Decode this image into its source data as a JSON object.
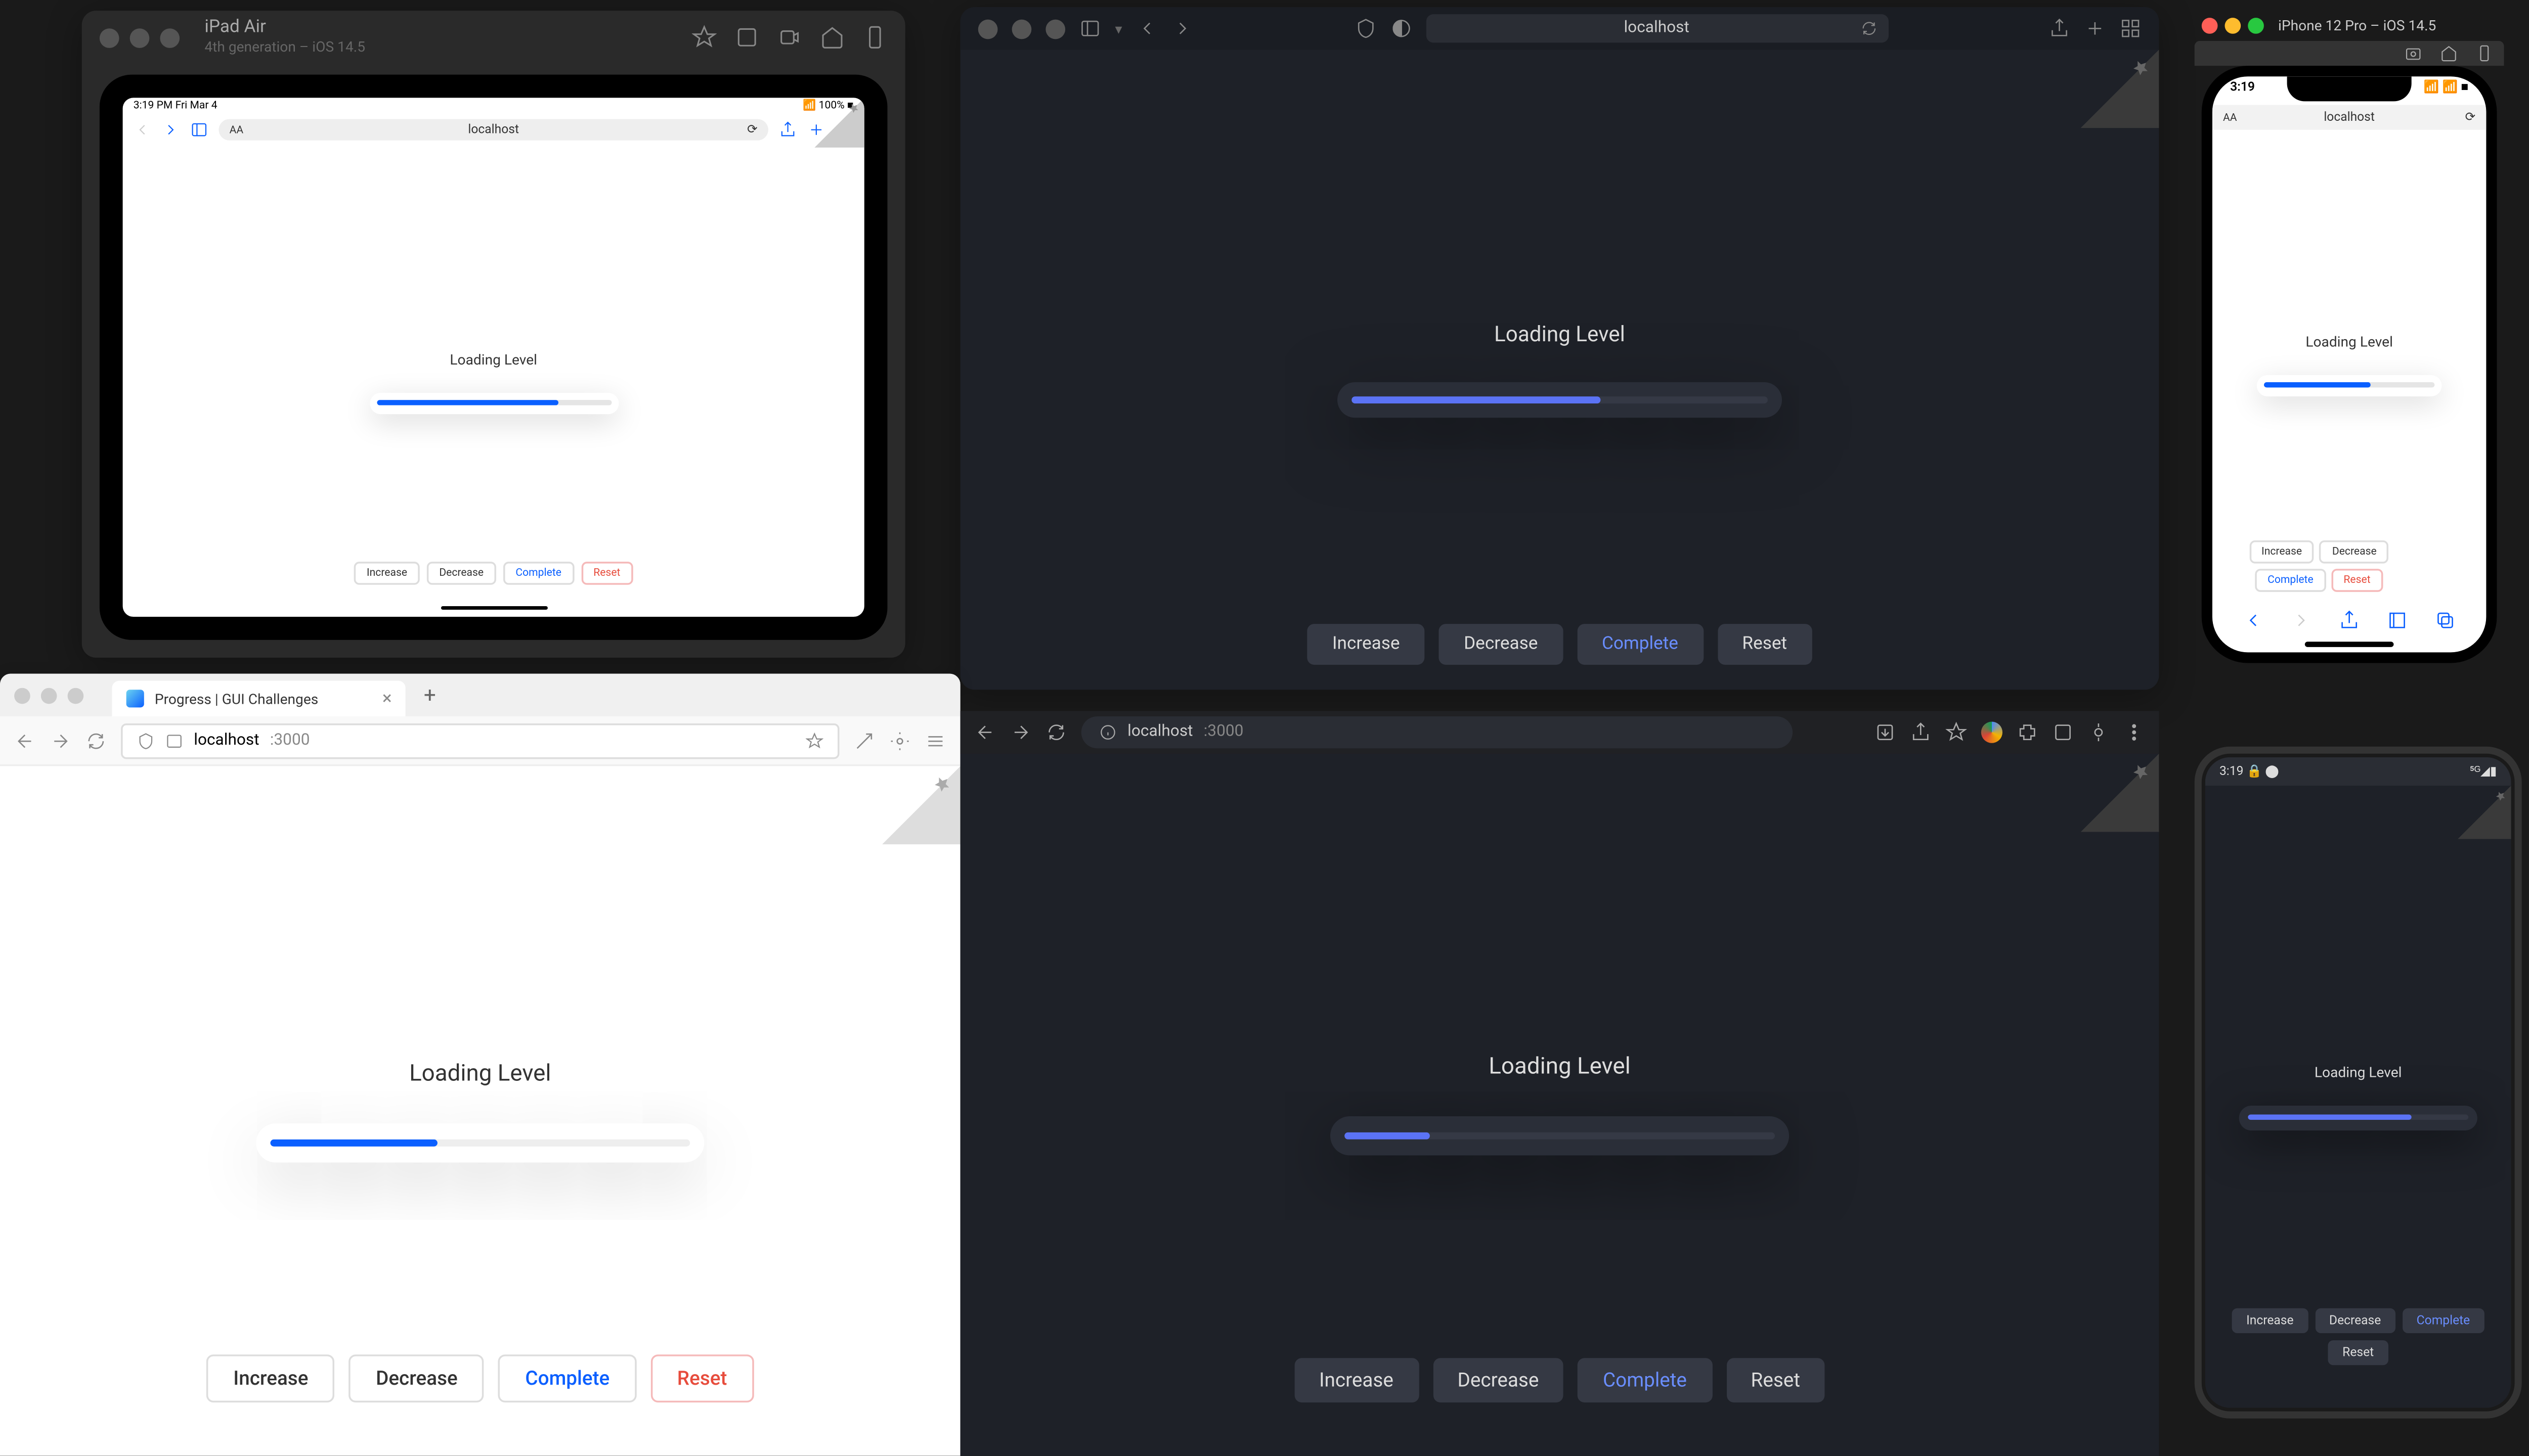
{
  "common": {
    "loading_label": "Loading Level",
    "buttons": {
      "increase": "Increase",
      "decrease": "Decrease",
      "complete": "Complete",
      "reset": "Reset"
    }
  },
  "ipad": {
    "device_name": "iPad Air",
    "device_sub": "4th generation – iOS 14.5",
    "statusbar_time": "3:19 PM  Fri Mar 4",
    "statusbar_right": "100%",
    "url": "localhost",
    "progress_percent": 78
  },
  "safari": {
    "url": "localhost",
    "progress_percent": 60
  },
  "iphone": {
    "device_name": "iPhone 12 Pro – iOS 14.5",
    "statusbar_time": "3:19",
    "url": "localhost",
    "progress_percent": 62
  },
  "firefox_light": {
    "tab_title": "Progress | GUI Challenges",
    "host": "localhost",
    "port": ":3000",
    "progress_percent": 40
  },
  "chrome_dark": {
    "host": "localhost",
    "port": ":3000",
    "progress_percent": 20
  },
  "android": {
    "statusbar_time": "3:19",
    "progress_percent": 74
  }
}
